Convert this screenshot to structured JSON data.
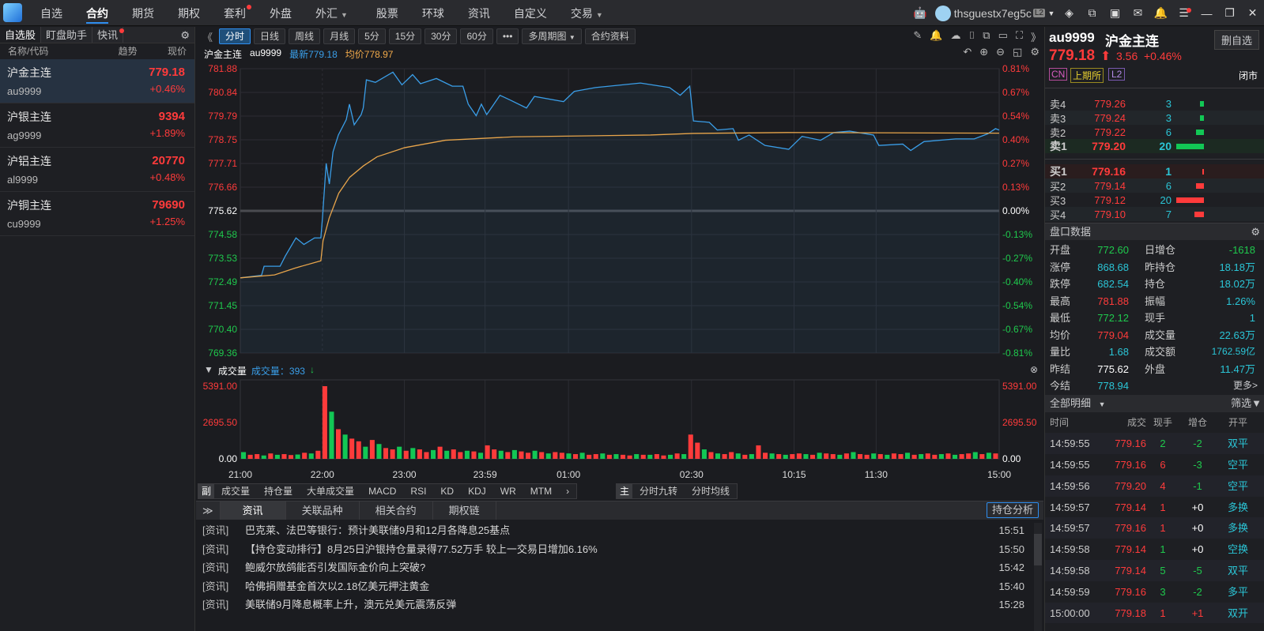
{
  "nav": {
    "items": [
      "自选",
      "合约",
      "期货",
      "期权",
      "套利",
      "外盘",
      "外汇",
      "股票",
      "环球",
      "资讯",
      "自定义",
      "交易"
    ],
    "active": 1,
    "user": "thsguestx7eg5c",
    "level": "L2"
  },
  "left": {
    "tabs": [
      "自选股",
      "盯盘助手",
      "快讯"
    ],
    "headers": [
      "名称/代码",
      "趋势",
      "现价"
    ],
    "items": [
      {
        "name": "沪金主连",
        "code": "au9999",
        "price": "779.18",
        "change": "+0.46%"
      },
      {
        "name": "沪银主连",
        "code": "ag9999",
        "price": "9394",
        "change": "+1.89%"
      },
      {
        "name": "沪铝主连",
        "code": "al9999",
        "price": "20770",
        "change": "+0.48%"
      },
      {
        "name": "沪铜主连",
        "code": "cu9999",
        "price": "79690",
        "change": "+1.25%"
      }
    ]
  },
  "toolbar": {
    "buttons": [
      "分时",
      "日线",
      "周线",
      "月线",
      "5分",
      "15分",
      "30分",
      "60分",
      "•••",
      "多周期图",
      "合约资料"
    ]
  },
  "info": {
    "name": "沪金主连",
    "code": "au9999",
    "latest": "最新779.18",
    "avg": "均价778.97"
  },
  "volume": {
    "label": "成交量",
    "current": "成交量：393"
  },
  "indicator_tabs": {
    "sub_label": "副",
    "items": [
      "成交量",
      "持仓量",
      "大单成交量",
      "MACD",
      "RSI",
      "KD",
      "KDJ",
      "WR",
      "MTM"
    ],
    "main_label": "主",
    "main_items": [
      "分时九转",
      "分时均线"
    ]
  },
  "bottom_tabs": {
    "items": [
      "资讯",
      "关联品种",
      "相关合约",
      "期权链"
    ],
    "right_button": "持仓分析"
  },
  "news": [
    {
      "tag": "[资讯]",
      "title": "巴克莱、法巴等银行：预计美联储9月和12月各降息25基点",
      "time": "15:51"
    },
    {
      "tag": "[资讯]",
      "title": "【持仓变动排行】8月25日沪银持仓量录得77.52万手   较上一交易日增加6.16%",
      "time": "15:50"
    },
    {
      "tag": "[资讯]",
      "title": "鲍威尔放鸽能否引发国际金价向上突破?",
      "time": "15:42"
    },
    {
      "tag": "[资讯]",
      "title": "哈佛捐赠基金首次以2.18亿美元押注黄金",
      "time": "15:40"
    },
    {
      "tag": "[资讯]",
      "title": "美联储9月降息概率上升，澳元兑美元震荡反弹",
      "time": "15:28"
    }
  ],
  "quote": {
    "code": "au9999",
    "name": "沪金主连",
    "remove_button": "删自选",
    "price": "779.18",
    "change": "3.56",
    "pct": "+0.46%",
    "badges": [
      "CN",
      "上期所",
      "L2"
    ],
    "status": "闭市"
  },
  "orderbook": {
    "asks": [
      {
        "label": "卖4",
        "price": "779.26",
        "vol": "3",
        "size": 3
      },
      {
        "label": "卖3",
        "price": "779.24",
        "vol": "3",
        "size": 3
      },
      {
        "label": "卖2",
        "price": "779.22",
        "vol": "6",
        "size": 6
      },
      {
        "label": "卖1",
        "price": "779.20",
        "vol": "20",
        "size": 20
      }
    ],
    "bids": [
      {
        "label": "买1",
        "price": "779.16",
        "vol": "1",
        "size": 1
      },
      {
        "label": "买2",
        "price": "779.14",
        "vol": "6",
        "size": 6
      },
      {
        "label": "买3",
        "price": "779.12",
        "vol": "20",
        "size": 20
      },
      {
        "label": "买4",
        "price": "779.10",
        "vol": "7",
        "size": 7
      }
    ]
  },
  "stats": {
    "title": "盘口数据",
    "more": "更多>",
    "rows": [
      [
        "开盘",
        "772.60",
        "日增仓",
        "-1618"
      ],
      [
        "涨停",
        "868.68",
        "昨持仓",
        "18.18万"
      ],
      [
        "跌停",
        "682.54",
        "持仓",
        "18.02万"
      ],
      [
        "最高",
        "781.88",
        "振幅",
        "1.26%"
      ],
      [
        "最低",
        "772.12",
        "现手",
        "1"
      ],
      [
        "均价",
        "779.04",
        "成交量",
        "22.63万"
      ],
      [
        "量比",
        "1.68",
        "成交额",
        "1762.59亿"
      ],
      [
        "昨结",
        "775.62",
        "外盘",
        "11.47万"
      ],
      [
        "今结",
        "778.94",
        "",
        ""
      ]
    ]
  },
  "ticks": {
    "title": "全部明细",
    "filter": "筛选",
    "headers": [
      "时间",
      "成交",
      "现手",
      "增仓",
      "开平"
    ],
    "rows": [
      [
        "14:59:55",
        "779.16",
        "2",
        "-2",
        "双平"
      ],
      [
        "14:59:55",
        "779.16",
        "6",
        "-3",
        "空平"
      ],
      [
        "14:59:56",
        "779.20",
        "4",
        "-1",
        "空平"
      ],
      [
        "14:59:57",
        "779.14",
        "1",
        "+0",
        "多换"
      ],
      [
        "14:59:57",
        "779.16",
        "1",
        "+0",
        "多换"
      ],
      [
        "14:59:58",
        "779.14",
        "1",
        "+0",
        "空换"
      ],
      [
        "14:59:58",
        "779.14",
        "5",
        "-5",
        "双平"
      ],
      [
        "14:59:59",
        "779.16",
        "3",
        "-2",
        "多平"
      ],
      [
        "15:00:00",
        "779.18",
        "1",
        "+1",
        "双开"
      ]
    ]
  },
  "chart_data": {
    "type": "line",
    "title": "沪金主连 分时",
    "prev_settle": 775.62,
    "ylim": [
      769.36,
      781.88
    ],
    "y_ticks": [
      "781.88",
      "780.84",
      "779.79",
      "778.75",
      "777.71",
      "776.66",
      "775.62",
      "774.58",
      "773.53",
      "772.49",
      "771.45",
      "770.40",
      "769.36"
    ],
    "pct_ticks": [
      "0.81%",
      "0.67%",
      "0.54%",
      "0.40%",
      "0.27%",
      "0.13%",
      "0.00%",
      "-0.13%",
      "-0.27%",
      "-0.40%",
      "-0.54%",
      "-0.67%",
      "-0.81%"
    ],
    "x_ticks": [
      {
        "label": "21:00",
        "idx": 0
      },
      {
        "label": "22:00",
        "idx": 60
      },
      {
        "label": "23:00",
        "idx": 120
      },
      {
        "label": "23:59",
        "idx": 179
      },
      {
        "label": "01:00",
        "idx": 240
      },
      {
        "label": "02:30",
        "idx": 330
      },
      {
        "label": "10:15",
        "idx": 405
      },
      {
        "label": "11:30",
        "idx": 465
      },
      {
        "label": "15:00",
        "idx": 555
      }
    ],
    "x_max": 555,
    "price": [
      [
        0,
        772.67
      ],
      [
        15.5,
        772.78
      ],
      [
        17.4,
        773.18
      ],
      [
        29.1,
        773.18
      ],
      [
        32.9,
        773.63
      ],
      [
        40.7,
        774.43
      ],
      [
        46.5,
        774.14
      ],
      [
        54.3,
        774.43
      ],
      [
        58.9,
        774.43
      ],
      [
        60.1,
        775.33
      ],
      [
        62.8,
        777.71
      ],
      [
        65.1,
        776.8
      ],
      [
        67.8,
        778.22
      ],
      [
        71.7,
        778.96
      ],
      [
        77.5,
        779.64
      ],
      [
        79.8,
        780.32
      ],
      [
        83.3,
        779.41
      ],
      [
        88.4,
        779.86
      ],
      [
        89.9,
        780.15
      ],
      [
        92.2,
        781.39
      ],
      [
        98.8,
        781.28
      ],
      [
        111.6,
        781.73
      ],
      [
        118.2,
        781.17
      ],
      [
        126,
        781.62
      ],
      [
        131.8,
        781.22
      ],
      [
        143.4,
        781.45
      ],
      [
        155,
        781.11
      ],
      [
        162.8,
        781.11
      ],
      [
        166.7,
        780.32
      ],
      [
        172.5,
        779.81
      ],
      [
        176.3,
        780.32
      ],
      [
        180.2,
        779.86
      ],
      [
        189.9,
        780.71
      ],
      [
        197.7,
        780.49
      ],
      [
        209.3,
        780.15
      ],
      [
        215.1,
        780.66
      ],
      [
        236.4,
        780.43
      ],
      [
        244.2,
        780.88
      ],
      [
        259.7,
        781.05
      ],
      [
        292.6,
        781.25
      ],
      [
        313.9,
        781.05
      ],
      [
        321.7,
        780.71
      ],
      [
        328.7,
        781.11
      ],
      [
        331.4,
        779.58
      ],
      [
        343,
        779.52
      ],
      [
        348.8,
        779.18
      ],
      [
        360.4,
        779.24
      ],
      [
        364.3,
        778.73
      ],
      [
        372.1,
        778.96
      ],
      [
        383.7,
        778.5
      ],
      [
        401.1,
        778.33
      ],
      [
        410.8,
        778.9
      ],
      [
        424.4,
        778.73
      ],
      [
        434.1,
        779.07
      ],
      [
        445.7,
        779.13
      ],
      [
        463.1,
        778.96
      ],
      [
        467,
        778.5
      ],
      [
        484.5,
        778.56
      ],
      [
        490.3,
        778.28
      ],
      [
        500,
        778.67
      ],
      [
        523.2,
        778.79
      ],
      [
        536.8,
        778.79
      ],
      [
        546.5,
        779.01
      ],
      [
        552.3,
        779.24
      ],
      [
        555,
        779.18
      ]
    ],
    "avg": [
      [
        0,
        772.67
      ],
      [
        25,
        772.8
      ],
      [
        40,
        773.1
      ],
      [
        58.9,
        773.42
      ],
      [
        60.5,
        774.3
      ],
      [
        65,
        775.3
      ],
      [
        72,
        776.4
      ],
      [
        80,
        777.1
      ],
      [
        90,
        777.6
      ],
      [
        100,
        778.0
      ],
      [
        120,
        778.4
      ],
      [
        150,
        778.73
      ],
      [
        200,
        778.88
      ],
      [
        300,
        778.96
      ],
      [
        331,
        779.03
      ],
      [
        400,
        779.07
      ],
      [
        555,
        779.04
      ]
    ],
    "volume_ticks": [
      "5391.00",
      "2695.50",
      "0.00"
    ],
    "volume_max": 5391,
    "volume": [
      500,
      300,
      350,
      250,
      400,
      300,
      350,
      280,
      320,
      450,
      400,
      600,
      5391,
      3500,
      2200,
      1800,
      1500,
      1300,
      900,
      1400,
      1100,
      800,
      700,
      900,
      600,
      800,
      700,
      500,
      650,
      900,
      600,
      700,
      500,
      600,
      550,
      450,
      1000,
      700,
      600,
      500,
      650,
      550,
      450,
      600,
      500,
      400,
      500,
      450,
      400,
      350,
      450,
      300,
      350,
      400,
      300,
      350,
      300,
      250,
      350,
      300,
      300,
      350,
      250,
      300,
      400,
      350,
      1800,
      1200,
      700,
      500,
      400,
      350,
      500,
      400,
      300,
      350,
      1000,
      450,
      400,
      350,
      300,
      350,
      400,
      350,
      300,
      450,
      400,
      350,
      300,
      400,
      500,
      350,
      300,
      400,
      350,
      300,
      400,
      350,
      450,
      300,
      350,
      400,
      300,
      350,
      400,
      300,
      350,
      400,
      500,
      350,
      450,
      400
    ]
  },
  "colors": {
    "up": "#ff3b3b",
    "down": "#1fc94d",
    "price_line": "#3a9ee8",
    "avg_line": "#e8a54b",
    "accent": "#2f8ff0"
  }
}
